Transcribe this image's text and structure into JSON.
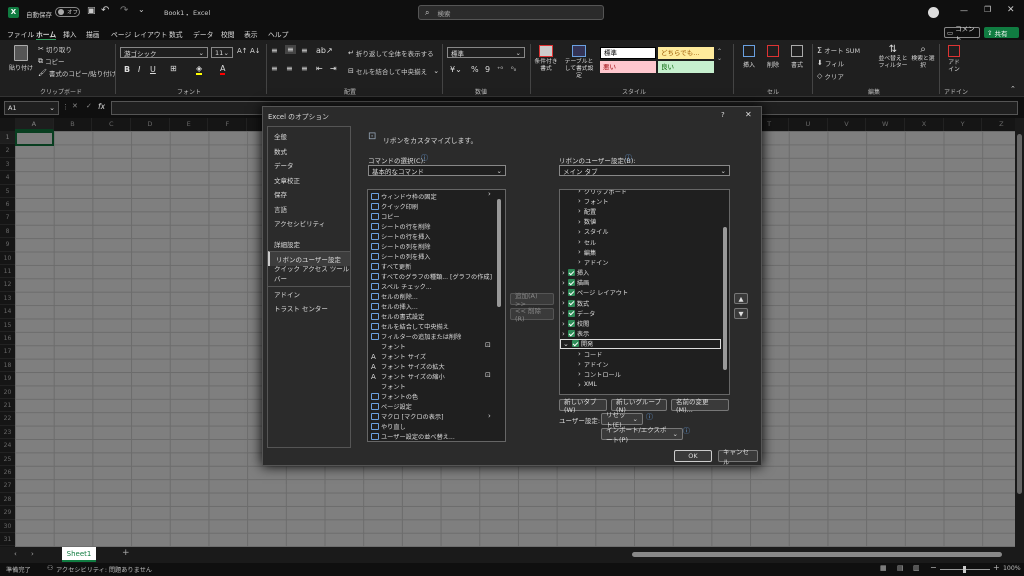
{
  "titlebar": {
    "autosave": "自動保存",
    "toggle": "オフ",
    "filename": "Book1",
    "sep": "・",
    "app": "Excel",
    "search": "検索"
  },
  "menu": [
    "ファイル",
    "ホーム",
    "挿入",
    "描画",
    "ページ レイアウト",
    "数式",
    "データ",
    "校閲",
    "表示",
    "ヘルプ"
  ],
  "menu_right": {
    "comment": "コメント",
    "share": "共有"
  },
  "ribbon": {
    "paste": "貼り付け",
    "cut": "切り取り",
    "copy": "コピー",
    "format_painter": "書式のコピー/貼り付け",
    "clipboard": "クリップボード",
    "font_name": "游ゴシック",
    "font_size": "11",
    "font": "フォント",
    "wrap": "折り返して全体を表示する",
    "merge": "セルを結合して中央揃え",
    "alignment": "配置",
    "number_format": "標準",
    "number": "数値",
    "cond_format": "条件付き書式",
    "table_format": "テーブルとして書式設定",
    "styles": {
      "normal": "標準",
      "neutral": "どちらでも...",
      "bad": "悪い",
      "good": "良い"
    },
    "style": "スタイル",
    "insert": "挿入",
    "delete": "削除",
    "format": "書式",
    "cells": "セル",
    "autosum": "オート SUM",
    "fill": "フィル",
    "clear": "クリア",
    "sort": "並べ替えとフィルター",
    "find": "検索と選択",
    "edit": "編集",
    "addins": "アドイン",
    "addins_group": "アドイン"
  },
  "formula": {
    "namebox": "A1",
    "fx": "fx"
  },
  "columns": [
    "A",
    "B",
    "C",
    "D",
    "E",
    "F",
    "G",
    "H",
    "I",
    "J",
    "K",
    "L",
    "M",
    "N",
    "O",
    "P",
    "Q",
    "R",
    "S",
    "T",
    "U",
    "V",
    "W",
    "X",
    "Y",
    "Z"
  ],
  "rows": [
    "1",
    "2",
    "3",
    "4",
    "5",
    "6",
    "7",
    "8",
    "9",
    "10",
    "11",
    "12",
    "13",
    "14",
    "15",
    "16",
    "17",
    "18",
    "19",
    "20",
    "21",
    "22",
    "23",
    "24",
    "25",
    "26",
    "27",
    "28",
    "29",
    "30",
    "31"
  ],
  "sheet": {
    "tab": "Sheet1"
  },
  "status": {
    "ready": "準備完了",
    "access": "アクセシビリティ: 問題ありません",
    "zoom": "100%"
  },
  "dialog": {
    "title": "Excel のオプション",
    "help": "?",
    "nav": [
      "全般",
      "数式",
      "データ",
      "文章校正",
      "保存",
      "言語",
      "アクセシビリティ",
      "詳細設定",
      "リボンのユーザー設定",
      "クイック アクセス ツール バー",
      "アドイン",
      "トラスト センター"
    ],
    "heading": "リボンをカスタマイズします。",
    "choose_label": "コマンドの選択(C):",
    "choose_value": "基本的なコマンド",
    "customize_label": "リボンのユーザー設定(B):",
    "customize_value": "メイン タブ",
    "commands": [
      "ウィンドウ枠の固定",
      "クイック印刷",
      "コピー",
      "シートの行を削除",
      "シートの行を挿入",
      "シートの列を削除",
      "シートの列を挿入",
      "すべて更新",
      "すべてのグラフの種類... [グラフの作成]",
      "スペル チェック...",
      "セルの削除...",
      "セルの挿入...",
      "セルの書式設定",
      "セルを結合して中央揃え",
      "フィルターの追加または削除",
      "フォント",
      "フォント サイズ",
      "フォント サイズの拡大",
      "フォント サイズの縮小",
      "フォント",
      "フォントの色",
      "ページ設定",
      "マクロ [マクロの表示]",
      "やり直し",
      "ユーザー設定の並べ替え...",
      "印刷プレビューと印刷"
    ],
    "add": "追加(A) >>",
    "remove": "<< 削除(R)",
    "tree_sub": [
      "クリップボード",
      "フォント",
      "配置",
      "数値",
      "スタイル",
      "セル",
      "編集",
      "アドイン"
    ],
    "tree_tabs": [
      "挿入",
      "描画",
      "ページ レイアウト",
      "数式",
      "データ",
      "校閲",
      "表示",
      "開発"
    ],
    "tree_dev": [
      "コード",
      "アドイン",
      "コントロール",
      "XML"
    ],
    "new_tab": "新しいタブ(W)",
    "new_group": "新しいグループ(N)",
    "rename": "名前の変更(M)...",
    "user_settings": "ユーザー設定:",
    "reset": "リセット(E)",
    "import_export": "インポート/エクスポート(P)",
    "ok": "OK",
    "cancel": "キャンセル"
  },
  "colors": {
    "accent": "#107c41",
    "dialog": "#2b2b2b"
  }
}
